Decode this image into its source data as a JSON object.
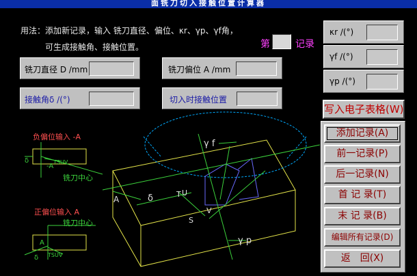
{
  "window": {
    "title": "面铣刀切入接触位置计算器"
  },
  "instructions": {
    "line1": "用法：添加新记录，输入 铣刀直径、偏位、κr、γp、γf角，",
    "line2": "可生成接触角、接触位置。"
  },
  "record": {
    "prefix": "第",
    "number": "",
    "suffix": "记录"
  },
  "inputs": {
    "diameter_label": "铣刀直径 D /mm",
    "diameter_value": "",
    "offset_label": "铣刀偏位 A /mm",
    "offset_value": "",
    "kr_label": "κr /(°)",
    "kr_value": "",
    "gf_label": "γf /(°)",
    "gf_value": "",
    "gp_label": "γp /(°)",
    "gp_value": ""
  },
  "outputs": {
    "contact_angle_label": "接触角δ /(°)",
    "contact_angle_value": "",
    "contact_pos_label": "切入时接触位置",
    "contact_pos_value": ""
  },
  "diagram": {
    "neg_offset_label": "负偏位输入 -A",
    "pos_offset_label": "正偏位输入 A",
    "cutter_center": "铣刀中心",
    "cutter_center2": "铣刀中心",
    "tsuv_neg": "TSUV",
    "tsuv_pos": "TSUV",
    "delta": "δ",
    "neg_a": "-A",
    "a": "A",
    "gamma_f": "γ f",
    "gamma_p": "γ p",
    "main_a": "A",
    "main_delta": "δ",
    "pt_t": "T",
    "pt_u": "U",
    "pt_s": "S",
    "pt_v": "V"
  },
  "buttons": {
    "excel": "写入电子表格(W)",
    "add": "添加记录(A)",
    "prev": "前一记录(P)",
    "next": "后一记录(N)",
    "first": "首 记 录(T)",
    "last": "末 记 录(B)",
    "edit_all": "编辑所有记录(D)",
    "back": "返　回(X)"
  },
  "colors": {
    "background": "#000000",
    "button_text": "#8b0000",
    "diagram_yellow": "#e6e64a",
    "diagram_green": "#3cd23c",
    "diagram_cyan": "#00aaff"
  }
}
